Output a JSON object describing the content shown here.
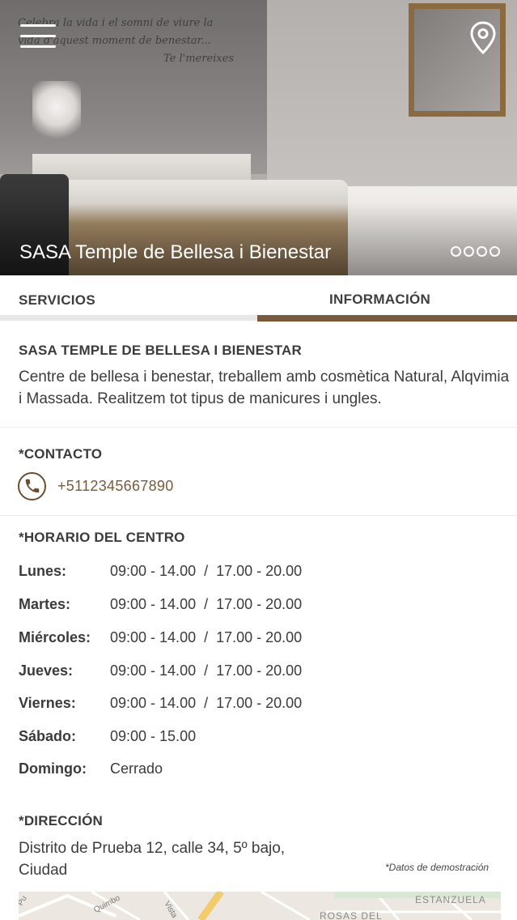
{
  "hero": {
    "title": "SASA Temple de Bellesa i Bienestar",
    "wall_text_1": "Celebra la vida i el somni de viure la",
    "wall_text_2": "vida d'aquest moment de benestar...",
    "wall_text_3": "Te l'mereixes",
    "slides_total": 4,
    "menu_icon": "hamburger-menu-icon",
    "location_icon": "map-pin-icon"
  },
  "tabs": [
    {
      "label": "SERVICIOS",
      "active": false
    },
    {
      "label": "INFORMACIÓN",
      "active": true
    }
  ],
  "info": {
    "business_name": "SASA TEMPLE DE BELLESA I BIENESTAR",
    "description": "Centre de bellesa i benestar, treballem amb cosmètica Natural, Alqvimia i Massada. Realitzem tot tipus de manicures i ungles."
  },
  "contact": {
    "title": "*CONTACTO",
    "phone": "+5112345667890",
    "icon": "phone-icon"
  },
  "schedule": {
    "title": "*HORARIO DEL CENTRO",
    "rows": [
      {
        "day": "Lunes:",
        "hours": "09:00 - 14.00  /  17.00 - 20.00"
      },
      {
        "day": "Martes:",
        "hours": "09:00 - 14.00  /  17.00 - 20.00"
      },
      {
        "day": "Miércoles:",
        "hours": "09:00 - 14.00  /  17.00 - 20.00"
      },
      {
        "day": "Jueves:",
        "hours": "09:00 - 14.00  /  17.00 - 20.00"
      },
      {
        "day": "Viernes:",
        "hours": "09:00 - 14.00  /  17.00 - 20.00"
      },
      {
        "day": "Sábado:",
        "hours": "09:00 - 15.00"
      },
      {
        "day": "Domingo:",
        "hours": "Cerrado"
      }
    ]
  },
  "address": {
    "title": "*DIRECCIÓN",
    "line1": "Distrito de Prueba 12, calle 34, 5º bajo,",
    "line2": "Ciudad",
    "demo_note": "*Datos de demostración"
  },
  "map": {
    "labels": [
      "ESTANZUELA",
      "ROSAS DEL",
      "Quimbo",
      "Vista",
      "Pu"
    ]
  },
  "colors": {
    "accent": "#7a5a3c",
    "tab_inactive_bar": "#e7e7e7",
    "text": "#3b3b3b"
  }
}
